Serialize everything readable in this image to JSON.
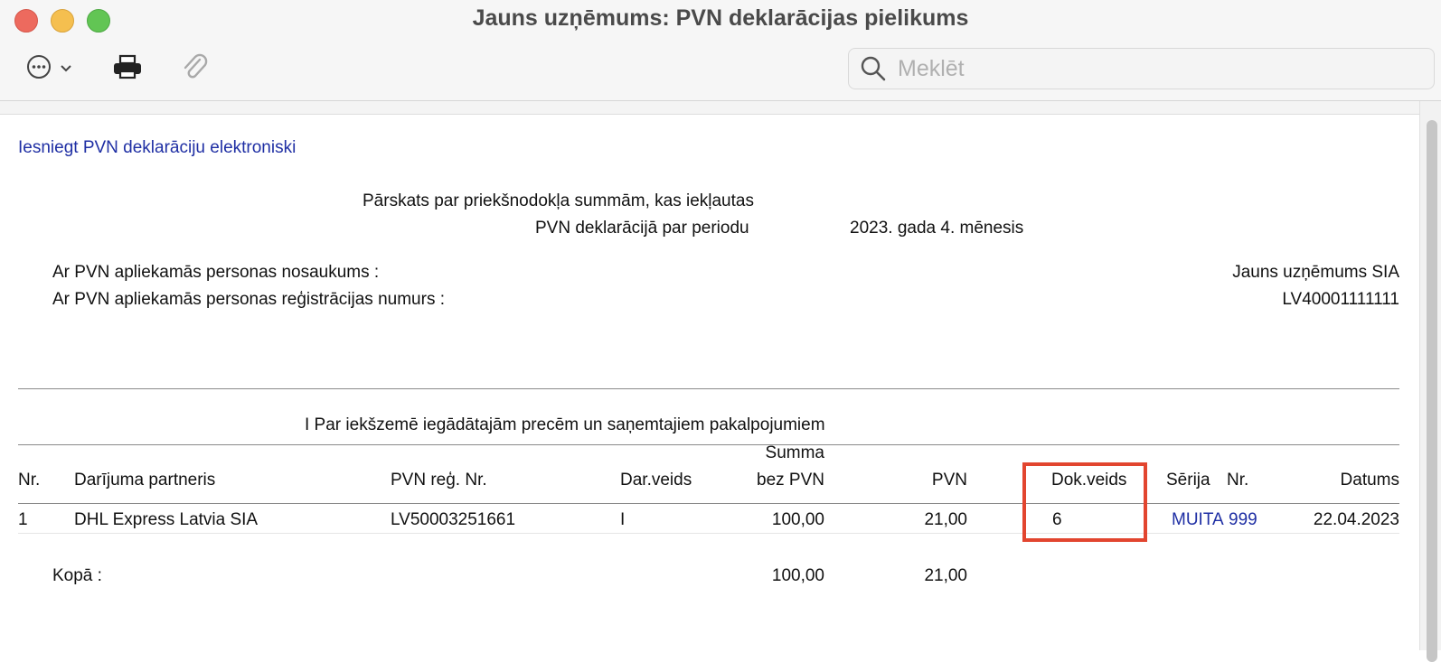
{
  "window": {
    "title": "Jauns uzņēmums: PVN deklarācijas pielikums"
  },
  "toolbar": {
    "more_icon": "ellipsis-circle-icon",
    "print_icon": "printer-icon",
    "attach_icon": "paperclip-icon"
  },
  "search": {
    "placeholder": "Meklēt",
    "value": ""
  },
  "report": {
    "submit_link": "Iesniegt PVN deklarāciju elektroniski",
    "heading_line1": "Pārskats par priekšnodokļa summām, kas iekļautas",
    "heading_line2": "PVN deklarācijā par periodu",
    "period": "2023. gada 4. mēnesis",
    "name_label": "Ar PVN apliekamās personas nosaukums :",
    "name_value": "Jauns uzņēmums SIA",
    "reg_label": "Ar PVN apliekamās personas reģistrācijas numurs :",
    "reg_value": "LV40001111111",
    "section_title": "I Par iekšzemē iegādātajām precēm un saņemtajiem pakalpojumiem"
  },
  "table": {
    "headers": {
      "nr": "Nr.",
      "partner": "Darījuma partneris",
      "reg_nr": "PVN reģ. Nr.",
      "dar_veids": "Dar.veids",
      "summa_line1": "Summa",
      "summa_line2": "bez PVN",
      "pvn": "PVN",
      "dok_veids": "Dok.veids",
      "serija": "Sērija",
      "doc_nr": "Nr.",
      "datums": "Datums"
    },
    "rows": [
      {
        "nr": "1",
        "partner": "DHL Express Latvia SIA",
        "reg_nr": "LV50003251661",
        "dar_veids": "I",
        "summa": "100,00",
        "pvn": "21,00",
        "dok_veids": "6",
        "serija": "MUITA",
        "doc_nr": "999",
        "datums": "22.04.2023"
      }
    ],
    "total": {
      "label": "Kopā :",
      "summa": "100,00",
      "pvn": "21,00"
    }
  },
  "colors": {
    "link": "#1f2fa4",
    "highlight": "#e2452f"
  }
}
